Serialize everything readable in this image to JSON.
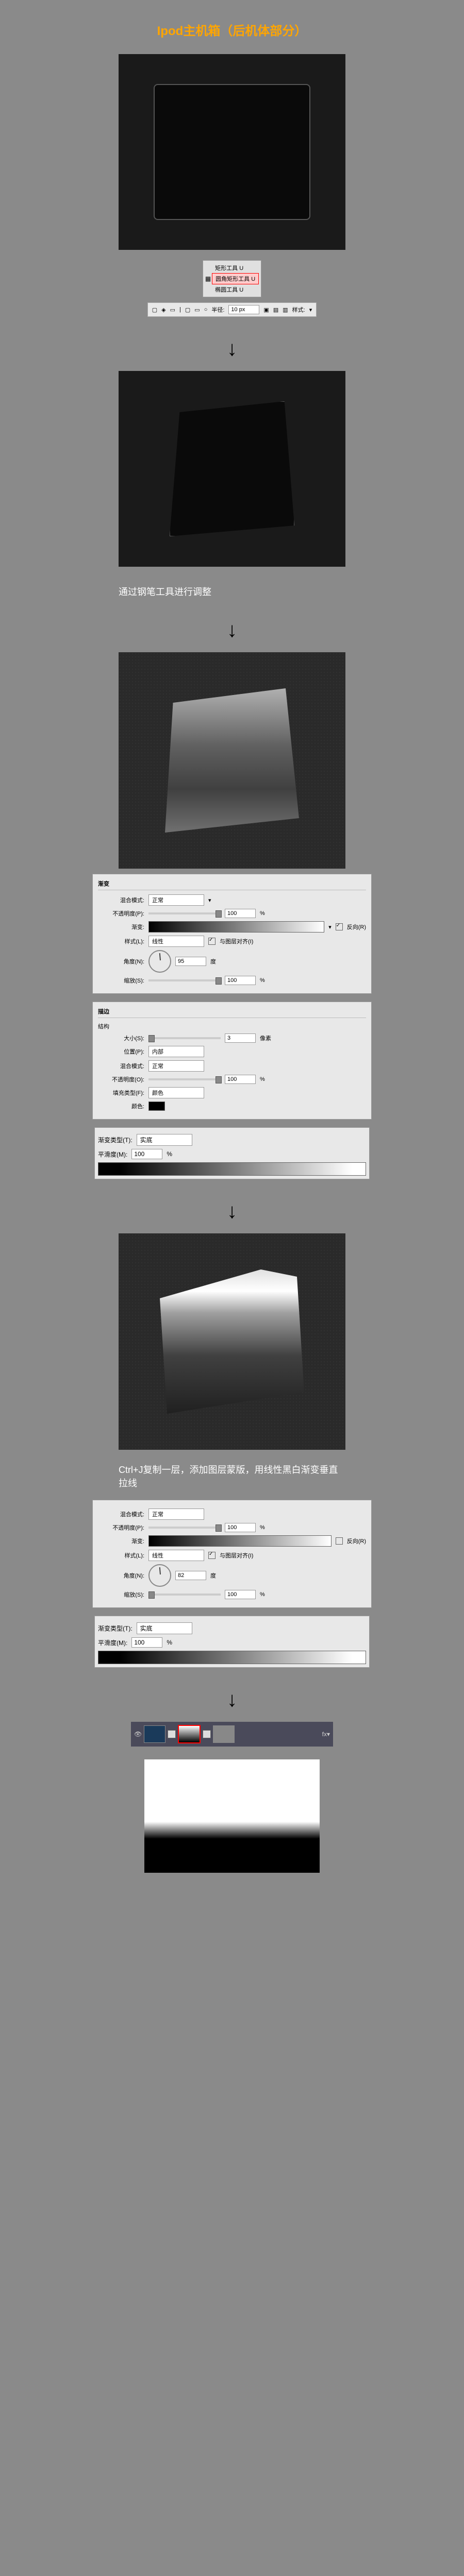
{
  "title": "Ipod主机箱（后机体部分）",
  "tools": {
    "t1": "矩形工具",
    "t2": "圆角矩形工具",
    "t3": "椭圆工具",
    "key": "U"
  },
  "toolbar": {
    "radius_label": "半径:",
    "radius_value": "10 px",
    "style_label": "样式:"
  },
  "caption1": "通过钢笔工具进行调整",
  "caption2": "Ctrl+J复制一层，添加图层蒙版，用线性黑白渐变垂直拉线",
  "grad_panel": {
    "title": "渐变",
    "blend_label": "混合模式:",
    "blend_val": "正常",
    "opacity_label": "不透明度(P):",
    "opacity_val": "100",
    "pct": "%",
    "grad_label": "渐变:",
    "reverse": "反向(R)",
    "style_label": "样式(L):",
    "style_val": "线性",
    "align": "与图层对齐(I)",
    "angle_label": "角度(N):",
    "angle_val": "95",
    "angle_unit": "度",
    "angle_val2": "82",
    "scale_label": "缩放(S):",
    "scale_val": "100"
  },
  "stroke_panel": {
    "title": "描边",
    "struct": "结构",
    "size_label": "大小(S):",
    "size_val": "3",
    "size_unit": "像素",
    "pos_label": "位置(P):",
    "pos_val": "内部",
    "blend_label": "混合模式:",
    "blend_val": "正常",
    "opacity_label": "不透明度(O):",
    "opacity_val": "100",
    "pct": "%",
    "fill_label": "填充类型(F):",
    "fill_val": "颜色",
    "color_label": "颜色:"
  },
  "grad_editor": {
    "type_label": "渐变类型(T):",
    "type_val": "实底",
    "smooth_label": "平滑度(M):",
    "smooth_val": "100",
    "pct": "%"
  }
}
